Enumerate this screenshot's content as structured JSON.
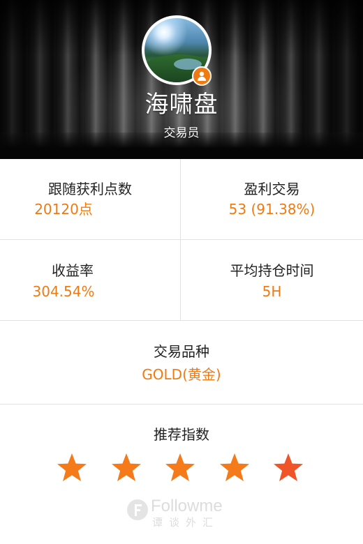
{
  "profile": {
    "name": "海啸盘",
    "role": "交易员",
    "badge_icon": "user-icon"
  },
  "stats": {
    "follow_points": {
      "label": "跟随获利点数",
      "value": "20120点"
    },
    "profitable_trades": {
      "label": "盈利交易",
      "value": "53 (91.38%)"
    },
    "return_rate": {
      "label": "收益率",
      "value": "304.54%"
    },
    "avg_holding": {
      "label": "平均持仓时间",
      "value": "5H"
    },
    "instrument": {
      "label": "交易品种",
      "value": "GOLD(黄金)"
    }
  },
  "rating": {
    "label": "推荐指数",
    "stars_filled": 5,
    "stars_total": 5
  },
  "watermark": {
    "brand": "Followme",
    "subtitle": "谭谈外汇"
  },
  "colors": {
    "accent": "#f07a12",
    "star": "#f47a1a",
    "star_last": "#f0552a",
    "divider": "#e2e2e2",
    "text": "#222222"
  }
}
